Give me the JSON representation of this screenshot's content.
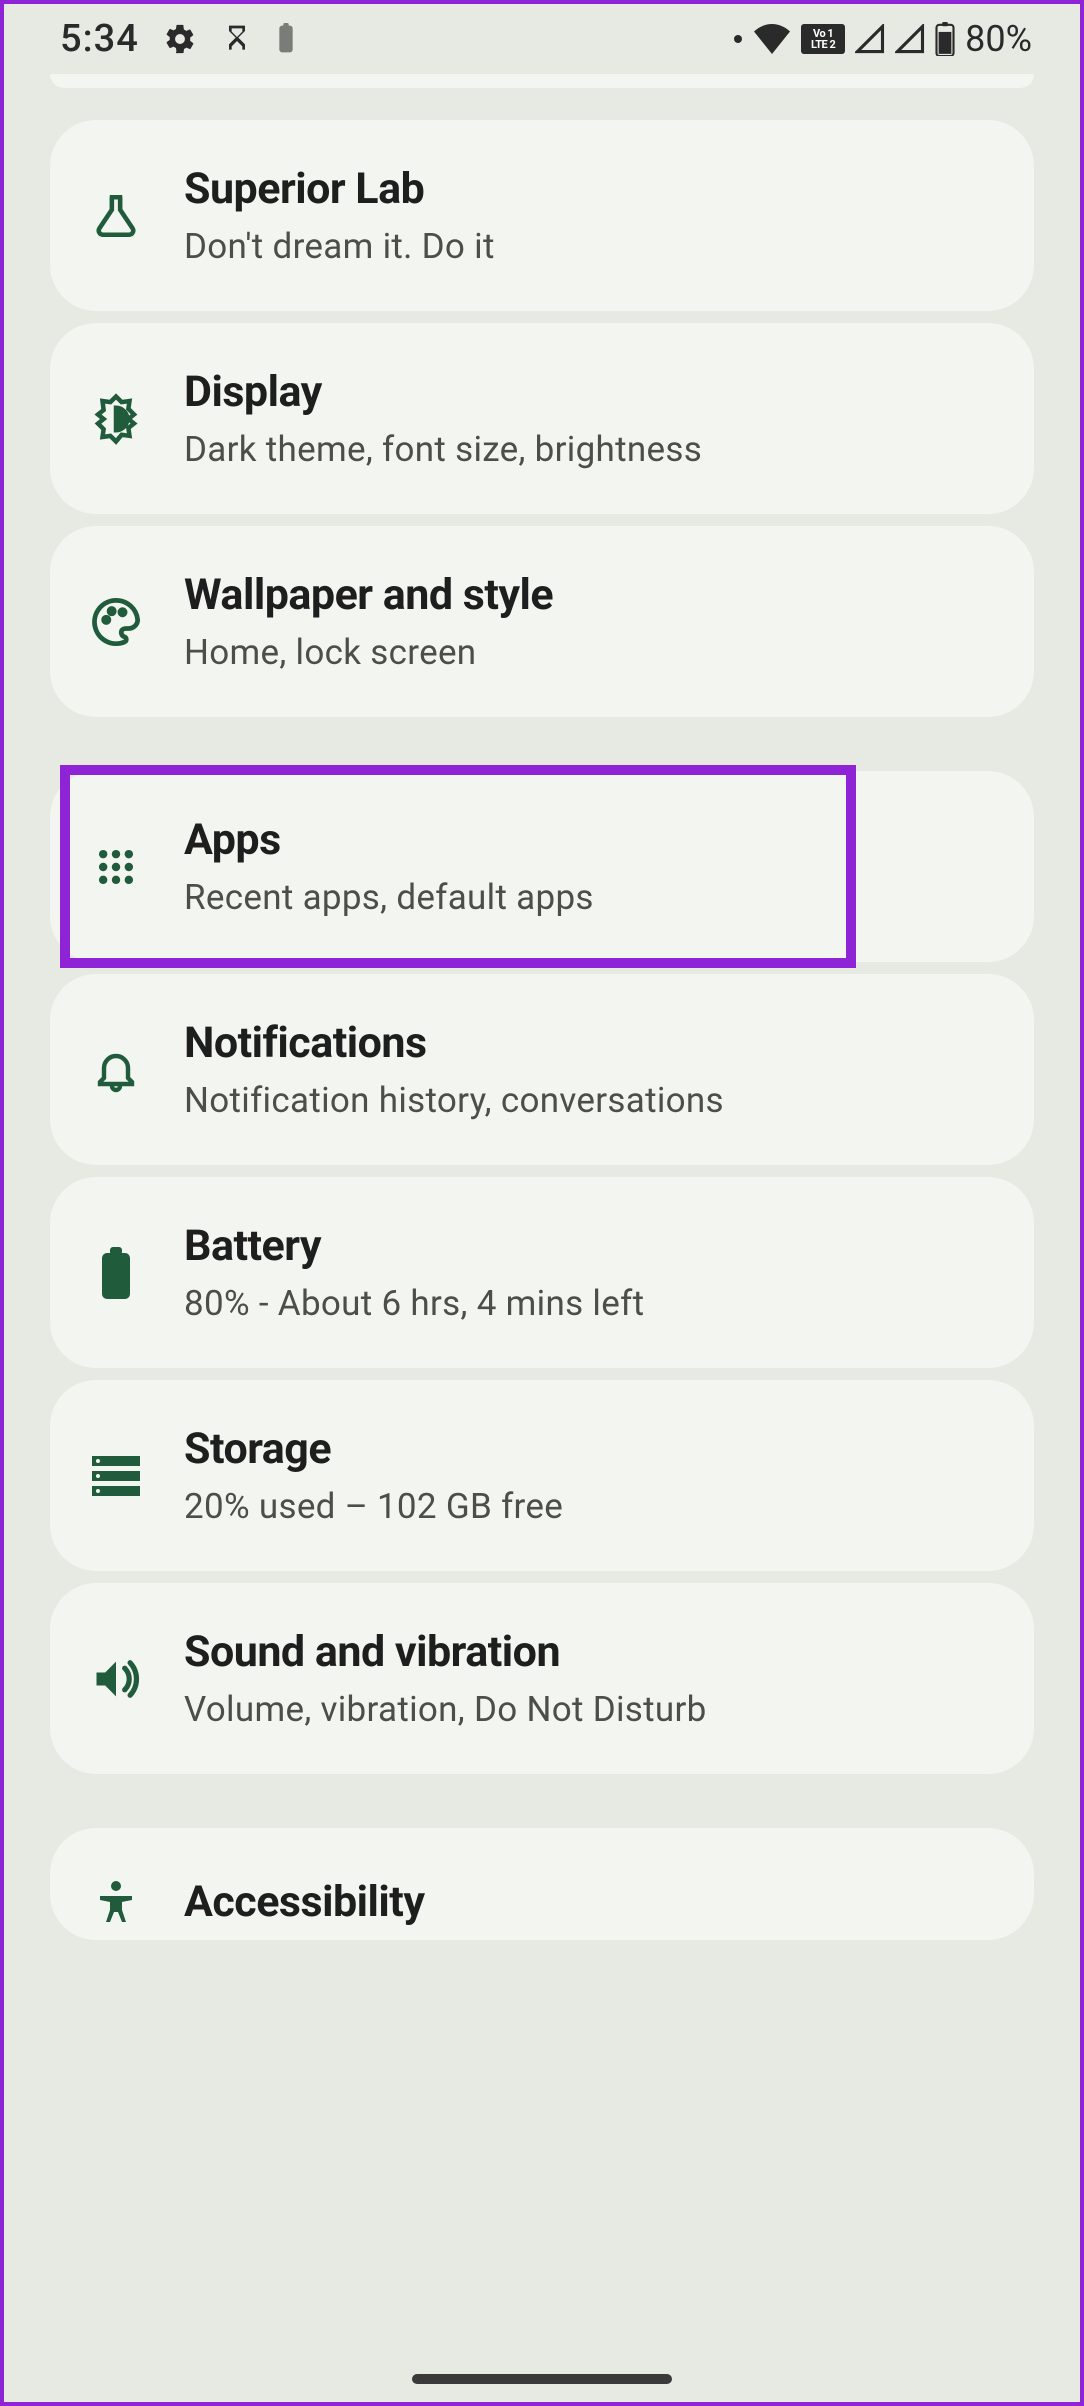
{
  "status": {
    "time": "5:34",
    "battery_percent": "80%"
  },
  "groups": [
    {
      "items": [
        {
          "id": "superior-lab",
          "icon": "flask",
          "title": "Superior Lab",
          "sub": "Don't dream it. Do it"
        },
        {
          "id": "display",
          "icon": "brightness",
          "title": "Display",
          "sub": "Dark theme, font size, brightness"
        },
        {
          "id": "wallpaper",
          "icon": "palette",
          "title": "Wallpaper and style",
          "sub": "Home, lock screen"
        }
      ]
    },
    {
      "items": [
        {
          "id": "apps",
          "icon": "grid",
          "title": "Apps",
          "sub": "Recent apps, default apps",
          "highlight": true
        },
        {
          "id": "notifications",
          "icon": "bell",
          "title": "Notifications",
          "sub": "Notification history, conversations"
        },
        {
          "id": "battery",
          "icon": "battery",
          "title": "Battery",
          "sub": "80% - About 6 hrs, 4 mins left"
        },
        {
          "id": "storage",
          "icon": "storage",
          "title": "Storage",
          "sub": "20% used – 102 GB free"
        },
        {
          "id": "sound",
          "icon": "volume",
          "title": "Sound and vibration",
          "sub": "Volume, vibration, Do Not Disturb"
        }
      ]
    },
    {
      "items": [
        {
          "id": "accessibility",
          "icon": "person",
          "title": "Accessibility",
          "sub": ""
        }
      ]
    }
  ]
}
